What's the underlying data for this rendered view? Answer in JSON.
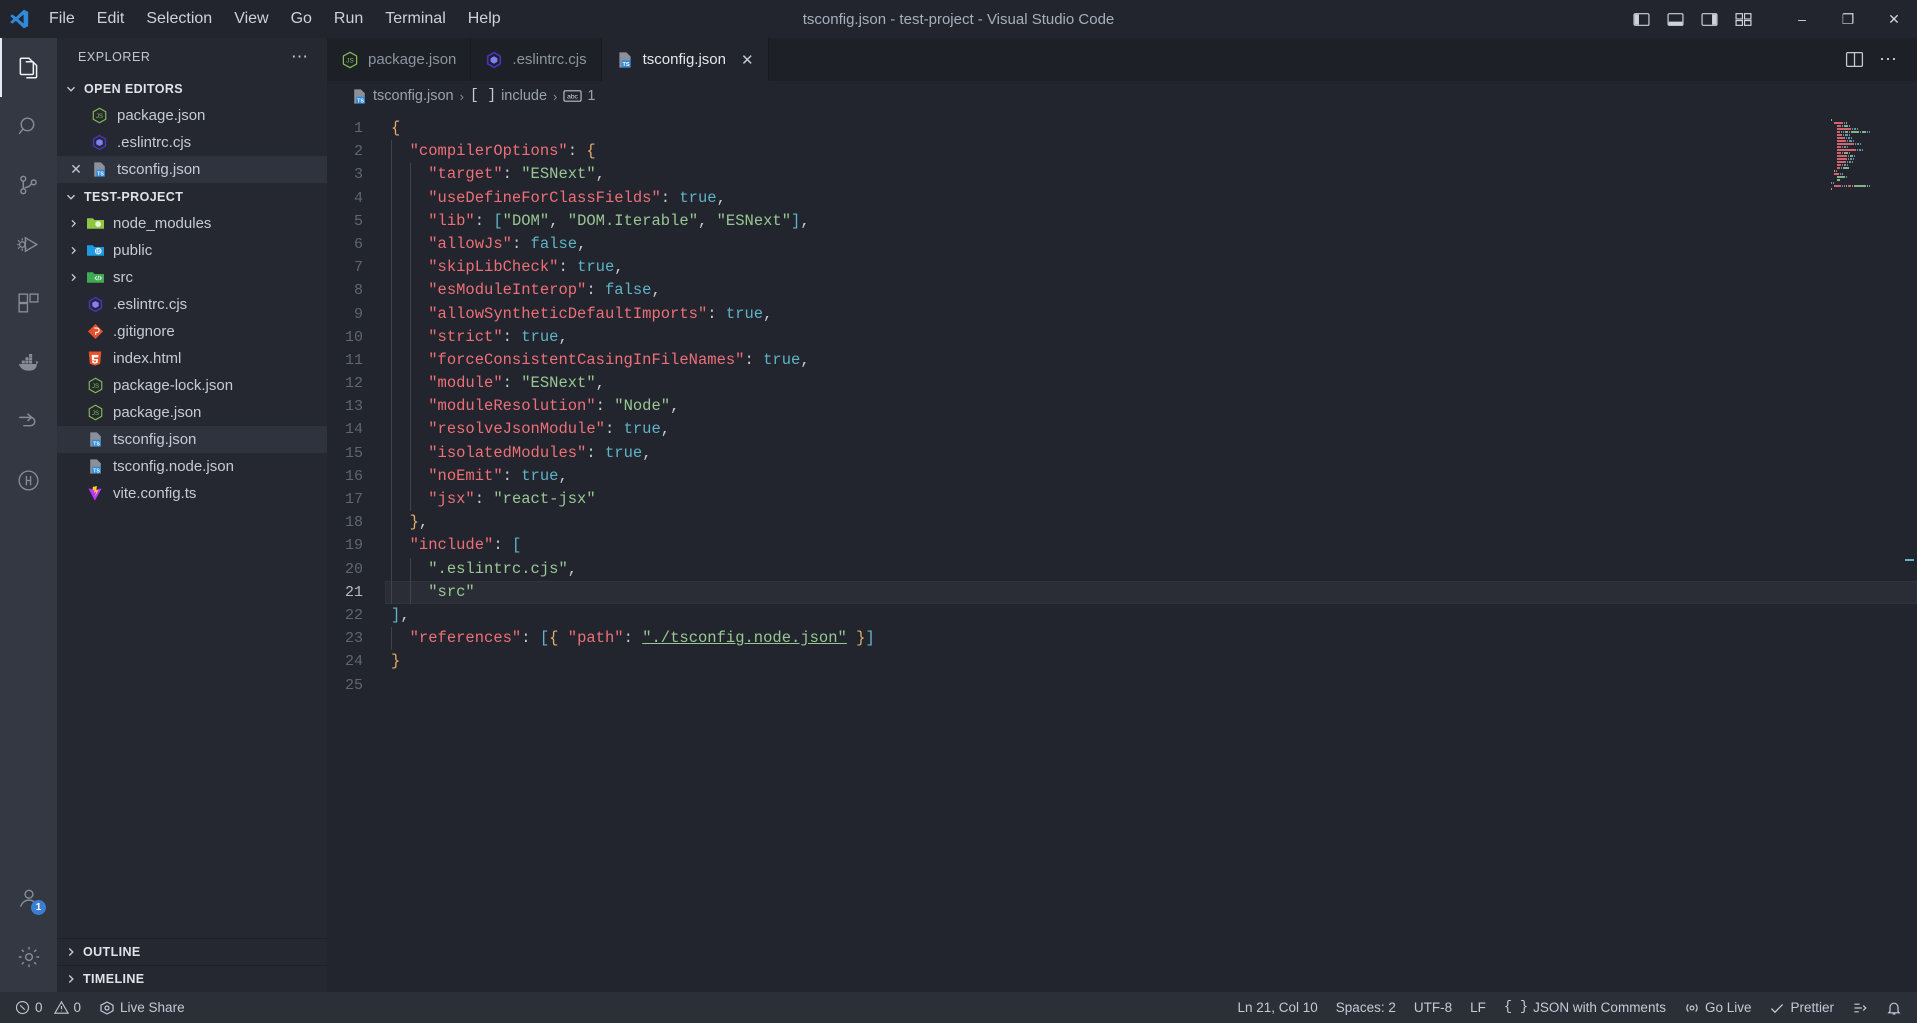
{
  "window": {
    "title": "tsconfig.json - test-project - Visual Studio Code",
    "minimize_label": "–",
    "maximize_label": "❐",
    "close_label": "✕"
  },
  "menubar": {
    "items": [
      {
        "label": "File"
      },
      {
        "label": "Edit"
      },
      {
        "label": "Selection"
      },
      {
        "label": "View"
      },
      {
        "label": "Go"
      },
      {
        "label": "Run"
      },
      {
        "label": "Terminal"
      },
      {
        "label": "Help"
      }
    ]
  },
  "activitybar": {
    "items": [
      {
        "name": "explorer",
        "icon": "files-icon",
        "active": true,
        "badge": ""
      },
      {
        "name": "search",
        "icon": "search-icon",
        "active": false,
        "badge": ""
      },
      {
        "name": "source-control",
        "icon": "source-control-icon",
        "active": false,
        "badge": ""
      },
      {
        "name": "run-and-debug",
        "icon": "run-debug-icon",
        "active": false,
        "badge": ""
      },
      {
        "name": "extensions",
        "icon": "extensions-icon",
        "active": false,
        "badge": ""
      },
      {
        "name": "docker",
        "icon": "docker-icon",
        "active": false,
        "badge": ""
      },
      {
        "name": "remote-explorer",
        "icon": "remote-explorer-icon",
        "active": false,
        "badge": ""
      },
      {
        "name": "test-explorer",
        "icon": "beaker-icon",
        "active": false,
        "badge": ""
      }
    ],
    "bottom": [
      {
        "name": "accounts",
        "icon": "account-icon",
        "badge": "1"
      },
      {
        "name": "settings",
        "icon": "gear-icon",
        "badge": ""
      }
    ]
  },
  "sidebar": {
    "title": "EXPLORER",
    "more_label": "⋯",
    "open_editors": {
      "label": "OPEN EDITORS",
      "expanded": true,
      "items": [
        {
          "label": "package.json",
          "icon": "nodejs-icon",
          "closable": false,
          "selected": false
        },
        {
          "label": ".eslintrc.cjs",
          "icon": "eslint-icon",
          "closable": false,
          "selected": false
        },
        {
          "label": "tsconfig.json",
          "icon": "typescript-config-icon",
          "closable": true,
          "selected": true
        }
      ]
    },
    "project": {
      "label": "TEST-PROJECT",
      "expanded": true,
      "items": [
        {
          "label": "node_modules",
          "icon": "folder-node-icon",
          "type": "folder",
          "expanded": false,
          "selected": false
        },
        {
          "label": "public",
          "icon": "folder-public-icon",
          "type": "folder",
          "expanded": false,
          "selected": false
        },
        {
          "label": "src",
          "icon": "folder-src-icon",
          "type": "folder",
          "expanded": false,
          "selected": false
        },
        {
          "label": ".eslintrc.cjs",
          "icon": "eslint-icon",
          "type": "file",
          "selected": false
        },
        {
          "label": ".gitignore",
          "icon": "git-icon",
          "type": "file",
          "selected": false
        },
        {
          "label": "index.html",
          "icon": "html5-icon",
          "type": "file",
          "selected": false
        },
        {
          "label": "package-lock.json",
          "icon": "nodejs-icon",
          "type": "file",
          "selected": false
        },
        {
          "label": "package.json",
          "icon": "nodejs-icon",
          "type": "file",
          "selected": false
        },
        {
          "label": "tsconfig.json",
          "icon": "typescript-config-icon",
          "type": "file",
          "selected": true
        },
        {
          "label": "tsconfig.node.json",
          "icon": "typescript-config-icon",
          "type": "file",
          "selected": false
        },
        {
          "label": "vite.config.ts",
          "icon": "vite-icon",
          "type": "file",
          "selected": false
        }
      ]
    },
    "outline": {
      "label": "OUTLINE",
      "expanded": false
    },
    "timeline": {
      "label": "TIMELINE",
      "expanded": false
    }
  },
  "editor": {
    "tabs": [
      {
        "label": "package.json",
        "icon": "nodejs-icon",
        "active": false,
        "closable": false
      },
      {
        "label": ".eslintrc.cjs",
        "icon": "eslint-icon",
        "active": false,
        "closable": false
      },
      {
        "label": "tsconfig.json",
        "icon": "typescript-config-icon",
        "active": true,
        "closable": true,
        "close_label": "✕"
      }
    ],
    "tab_actions": [
      {
        "name": "split-editor-right",
        "icon": "split-editor-icon"
      },
      {
        "name": "more-actions",
        "icon": "ellipsis-icon",
        "label": "⋯"
      }
    ],
    "breadcrumb": [
      {
        "label": "tsconfig.json",
        "icon": "typescript-config-icon"
      },
      {
        "label": "include",
        "icon": "array-icon",
        "icon_text": "[ ]"
      },
      {
        "label": "1",
        "icon": "string-icon",
        "icon_text": "abc"
      }
    ],
    "separator": "›",
    "current_line": 21,
    "lines": [
      {
        "n": 1,
        "indent": 0,
        "tokens": [
          {
            "t": "{",
            "c": "brace"
          }
        ]
      },
      {
        "n": 2,
        "indent": 1,
        "tokens": [
          {
            "t": "\"compilerOptions\"",
            "c": "prop"
          },
          {
            "t": ": ",
            "c": "punc"
          },
          {
            "t": "{",
            "c": "brace"
          }
        ]
      },
      {
        "n": 3,
        "indent": 2,
        "tokens": [
          {
            "t": "\"target\"",
            "c": "prop"
          },
          {
            "t": ": ",
            "c": "punc"
          },
          {
            "t": "\"ESNext\"",
            "c": "str"
          },
          {
            "t": ",",
            "c": "punc"
          }
        ]
      },
      {
        "n": 4,
        "indent": 2,
        "tokens": [
          {
            "t": "\"useDefineForClassFields\"",
            "c": "prop"
          },
          {
            "t": ": ",
            "c": "punc"
          },
          {
            "t": "true",
            "c": "lit"
          },
          {
            "t": ",",
            "c": "punc"
          }
        ]
      },
      {
        "n": 5,
        "indent": 2,
        "tokens": [
          {
            "t": "\"lib\"",
            "c": "prop"
          },
          {
            "t": ": ",
            "c": "punc"
          },
          {
            "t": "[",
            "c": "brk"
          },
          {
            "t": "\"DOM\"",
            "c": "str"
          },
          {
            "t": ", ",
            "c": "punc"
          },
          {
            "t": "\"DOM.Iterable\"",
            "c": "str"
          },
          {
            "t": ", ",
            "c": "punc"
          },
          {
            "t": "\"ESNext\"",
            "c": "str"
          },
          {
            "t": "]",
            "c": "brk"
          },
          {
            "t": ",",
            "c": "punc"
          }
        ]
      },
      {
        "n": 6,
        "indent": 2,
        "tokens": [
          {
            "t": "\"allowJs\"",
            "c": "prop"
          },
          {
            "t": ": ",
            "c": "punc"
          },
          {
            "t": "false",
            "c": "lit"
          },
          {
            "t": ",",
            "c": "punc"
          }
        ]
      },
      {
        "n": 7,
        "indent": 2,
        "tokens": [
          {
            "t": "\"skipLibCheck\"",
            "c": "prop"
          },
          {
            "t": ": ",
            "c": "punc"
          },
          {
            "t": "true",
            "c": "lit"
          },
          {
            "t": ",",
            "c": "punc"
          }
        ]
      },
      {
        "n": 8,
        "indent": 2,
        "tokens": [
          {
            "t": "\"esModuleInterop\"",
            "c": "prop"
          },
          {
            "t": ": ",
            "c": "punc"
          },
          {
            "t": "false",
            "c": "lit"
          },
          {
            "t": ",",
            "c": "punc"
          }
        ]
      },
      {
        "n": 9,
        "indent": 2,
        "tokens": [
          {
            "t": "\"allowSyntheticDefaultImports\"",
            "c": "prop"
          },
          {
            "t": ": ",
            "c": "punc"
          },
          {
            "t": "true",
            "c": "lit"
          },
          {
            "t": ",",
            "c": "punc"
          }
        ]
      },
      {
        "n": 10,
        "indent": 2,
        "tokens": [
          {
            "t": "\"strict\"",
            "c": "prop"
          },
          {
            "t": ": ",
            "c": "punc"
          },
          {
            "t": "true",
            "c": "lit"
          },
          {
            "t": ",",
            "c": "punc"
          }
        ]
      },
      {
        "n": 11,
        "indent": 2,
        "tokens": [
          {
            "t": "\"forceConsistentCasingInFileNames\"",
            "c": "prop"
          },
          {
            "t": ": ",
            "c": "punc"
          },
          {
            "t": "true",
            "c": "lit"
          },
          {
            "t": ",",
            "c": "punc"
          }
        ]
      },
      {
        "n": 12,
        "indent": 2,
        "tokens": [
          {
            "t": "\"module\"",
            "c": "prop"
          },
          {
            "t": ": ",
            "c": "punc"
          },
          {
            "t": "\"ESNext\"",
            "c": "str"
          },
          {
            "t": ",",
            "c": "punc"
          }
        ]
      },
      {
        "n": 13,
        "indent": 2,
        "tokens": [
          {
            "t": "\"moduleResolution\"",
            "c": "prop"
          },
          {
            "t": ": ",
            "c": "punc"
          },
          {
            "t": "\"Node\"",
            "c": "str"
          },
          {
            "t": ",",
            "c": "punc"
          }
        ]
      },
      {
        "n": 14,
        "indent": 2,
        "tokens": [
          {
            "t": "\"resolveJsonModule\"",
            "c": "prop"
          },
          {
            "t": ": ",
            "c": "punc"
          },
          {
            "t": "true",
            "c": "lit"
          },
          {
            "t": ",",
            "c": "punc"
          }
        ]
      },
      {
        "n": 15,
        "indent": 2,
        "tokens": [
          {
            "t": "\"isolatedModules\"",
            "c": "prop"
          },
          {
            "t": ": ",
            "c": "punc"
          },
          {
            "t": "true",
            "c": "lit"
          },
          {
            "t": ",",
            "c": "punc"
          }
        ]
      },
      {
        "n": 16,
        "indent": 2,
        "tokens": [
          {
            "t": "\"noEmit\"",
            "c": "prop"
          },
          {
            "t": ": ",
            "c": "punc"
          },
          {
            "t": "true",
            "c": "lit"
          },
          {
            "t": ",",
            "c": "punc"
          }
        ]
      },
      {
        "n": 17,
        "indent": 2,
        "tokens": [
          {
            "t": "\"jsx\"",
            "c": "prop"
          },
          {
            "t": ": ",
            "c": "punc"
          },
          {
            "t": "\"react-jsx\"",
            "c": "str"
          }
        ]
      },
      {
        "n": 18,
        "indent": 1,
        "tokens": [
          {
            "t": "}",
            "c": "brace"
          },
          {
            "t": ",",
            "c": "punc"
          }
        ]
      },
      {
        "n": 19,
        "indent": 1,
        "tokens": [
          {
            "t": "\"include\"",
            "c": "prop"
          },
          {
            "t": ": ",
            "c": "punc"
          },
          {
            "t": "[",
            "c": "brk"
          }
        ]
      },
      {
        "n": 20,
        "indent": 2,
        "tokens": [
          {
            "t": "\".eslintrc.cjs\"",
            "c": "str"
          },
          {
            "t": ",",
            "c": "punc"
          }
        ]
      },
      {
        "n": 21,
        "indent": 2,
        "tokens": [
          {
            "t": "\"src\"",
            "c": "str"
          }
        ]
      },
      {
        "n": 22,
        "indent": 0,
        "tokens": [
          {
            "t": "]",
            "c": "brk"
          },
          {
            "t": ",",
            "c": "punc"
          }
        ]
      },
      {
        "n": 23,
        "indent": 1,
        "tokens": [
          {
            "t": "\"references\"",
            "c": "prop"
          },
          {
            "t": ": ",
            "c": "punc"
          },
          {
            "t": "[",
            "c": "brk"
          },
          {
            "t": "{ ",
            "c": "brace"
          },
          {
            "t": "\"path\"",
            "c": "prop"
          },
          {
            "t": ": ",
            "c": "punc"
          },
          {
            "t": "\"./tsconfig.node.json\"",
            "c": "link"
          },
          {
            "t": " }",
            "c": "brace"
          },
          {
            "t": "]",
            "c": "brk"
          }
        ]
      },
      {
        "n": 24,
        "indent": 0,
        "tokens": [
          {
            "t": "}",
            "c": "brace"
          }
        ]
      },
      {
        "n": 25,
        "indent": 0,
        "tokens": []
      }
    ]
  },
  "statusbar": {
    "left": [
      {
        "name": "problems",
        "icon": "error-warning-icon",
        "label": "0  0",
        "errors": "0",
        "warnings": "0"
      },
      {
        "name": "live-share",
        "icon": "live-share-icon",
        "label": "Live Share"
      }
    ],
    "right": [
      {
        "name": "cursor-position",
        "label": "Ln 21, Col 10"
      },
      {
        "name": "indentation",
        "label": "Spaces: 2"
      },
      {
        "name": "encoding",
        "label": "UTF-8"
      },
      {
        "name": "eol",
        "label": "LF"
      },
      {
        "name": "language-mode",
        "icon": "braces-icon",
        "label": "JSON with Comments"
      },
      {
        "name": "go-live",
        "icon": "broadcast-icon",
        "label": "Go Live"
      },
      {
        "name": "prettier",
        "icon": "check-icon",
        "label": "Prettier"
      },
      {
        "name": "remote-indicator",
        "icon": "remote-icon",
        "label": ""
      },
      {
        "name": "notifications",
        "icon": "bell-icon",
        "label": ""
      }
    ]
  },
  "colors": {
    "accent": "#3b7fd4",
    "titlebar_bg": "#22252d",
    "activitybar_bg": "#333842",
    "sidebar_bg": "#252830",
    "editor_bg": "#22252d",
    "statusbar_bg": "#2b2f38",
    "property": "#ee6f77",
    "string": "#99c794",
    "literal": "#5fb3c7",
    "brace": "#e0ae6a"
  }
}
